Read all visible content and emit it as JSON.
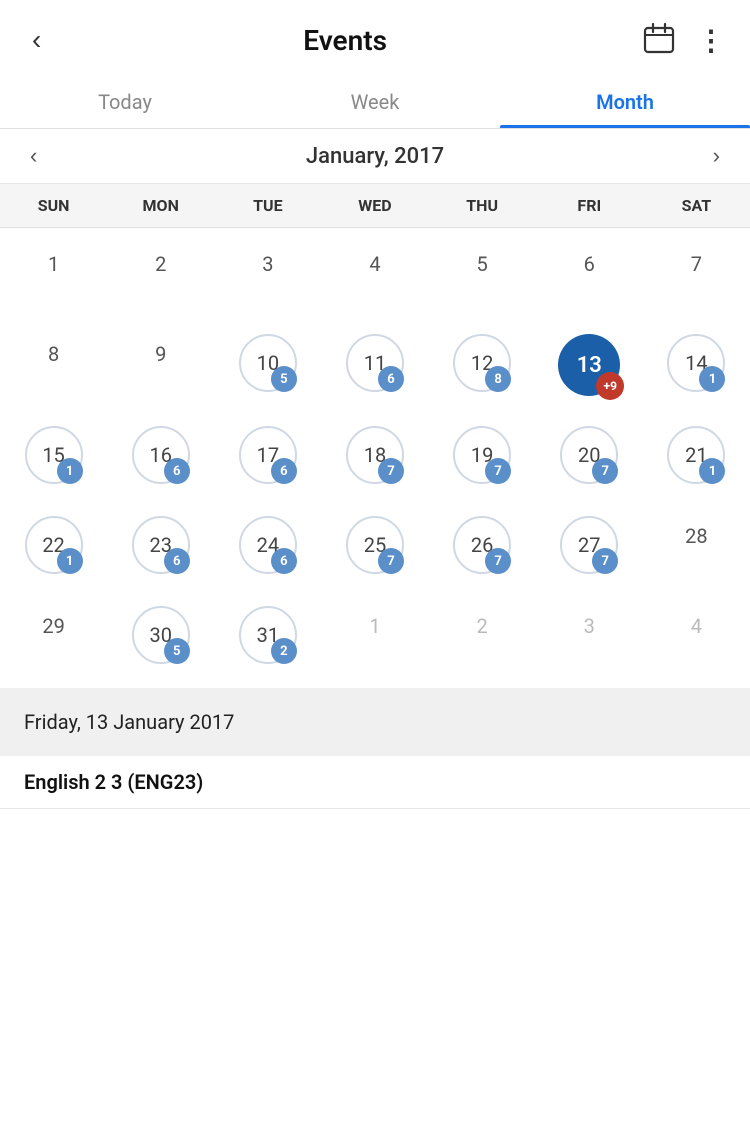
{
  "header": {
    "title": "Events",
    "back_label": "‹",
    "calendar_icon": "calendar-icon",
    "more_icon": "more-icon"
  },
  "tabs": [
    {
      "id": "today",
      "label": "Today",
      "active": false
    },
    {
      "id": "week",
      "label": "Week",
      "active": false
    },
    {
      "id": "month",
      "label": "Month",
      "active": true
    }
  ],
  "month_nav": {
    "title": "January, 2017",
    "prev_label": "‹",
    "next_label": "›"
  },
  "day_headers": [
    "SUN",
    "MON",
    "TUE",
    "WED",
    "THU",
    "FRI",
    "SAT"
  ],
  "calendar": {
    "weeks": [
      [
        {
          "date": "1",
          "other": false,
          "badge": null,
          "ring": false,
          "selected": false
        },
        {
          "date": "2",
          "other": false,
          "badge": null,
          "ring": false,
          "selected": false
        },
        {
          "date": "3",
          "other": false,
          "badge": null,
          "ring": false,
          "selected": false
        },
        {
          "date": "4",
          "other": false,
          "badge": null,
          "ring": false,
          "selected": false
        },
        {
          "date": "5",
          "other": false,
          "badge": null,
          "ring": false,
          "selected": false
        },
        {
          "date": "6",
          "other": false,
          "badge": null,
          "ring": false,
          "selected": false
        },
        {
          "date": "7",
          "other": false,
          "badge": null,
          "ring": false,
          "selected": false
        }
      ],
      [
        {
          "date": "8",
          "other": false,
          "badge": null,
          "ring": false,
          "selected": false
        },
        {
          "date": "9",
          "other": false,
          "badge": null,
          "ring": false,
          "selected": false
        },
        {
          "date": "10",
          "other": false,
          "badge": "5",
          "ring": true,
          "selected": false
        },
        {
          "date": "11",
          "other": false,
          "badge": "6",
          "ring": true,
          "selected": false
        },
        {
          "date": "12",
          "other": false,
          "badge": "8",
          "ring": true,
          "selected": false
        },
        {
          "date": "13",
          "other": false,
          "badge": "+9",
          "ring": false,
          "selected": true,
          "badge_red": true
        },
        {
          "date": "14",
          "other": false,
          "badge": "1",
          "ring": true,
          "selected": false
        }
      ],
      [
        {
          "date": "15",
          "other": false,
          "badge": "1",
          "ring": true,
          "selected": false
        },
        {
          "date": "16",
          "other": false,
          "badge": "6",
          "ring": true,
          "selected": false
        },
        {
          "date": "17",
          "other": false,
          "badge": "6",
          "ring": true,
          "selected": false
        },
        {
          "date": "18",
          "other": false,
          "badge": "7",
          "ring": true,
          "selected": false
        },
        {
          "date": "19",
          "other": false,
          "badge": "7",
          "ring": true,
          "selected": false
        },
        {
          "date": "20",
          "other": false,
          "badge": "7",
          "ring": true,
          "selected": false
        },
        {
          "date": "21",
          "other": false,
          "badge": "1",
          "ring": true,
          "selected": false
        }
      ],
      [
        {
          "date": "22",
          "other": false,
          "badge": "1",
          "ring": true,
          "selected": false
        },
        {
          "date": "23",
          "other": false,
          "badge": "6",
          "ring": true,
          "selected": false
        },
        {
          "date": "24",
          "other": false,
          "badge": "6",
          "ring": true,
          "selected": false
        },
        {
          "date": "25",
          "other": false,
          "badge": "7",
          "ring": true,
          "selected": false
        },
        {
          "date": "26",
          "other": false,
          "badge": "7",
          "ring": true,
          "selected": false
        },
        {
          "date": "27",
          "other": false,
          "badge": "7",
          "ring": true,
          "selected": false
        },
        {
          "date": "28",
          "other": false,
          "badge": null,
          "ring": false,
          "selected": false
        }
      ],
      [
        {
          "date": "29",
          "other": false,
          "badge": null,
          "ring": false,
          "selected": false
        },
        {
          "date": "30",
          "other": false,
          "badge": "5",
          "ring": true,
          "selected": false
        },
        {
          "date": "31",
          "other": false,
          "badge": "2",
          "ring": true,
          "selected": false
        },
        {
          "date": "1",
          "other": true,
          "badge": null,
          "ring": false,
          "selected": false
        },
        {
          "date": "2",
          "other": true,
          "badge": null,
          "ring": false,
          "selected": false
        },
        {
          "date": "3",
          "other": true,
          "badge": null,
          "ring": false,
          "selected": false
        },
        {
          "date": "4",
          "other": true,
          "badge": null,
          "ring": false,
          "selected": false
        }
      ]
    ]
  },
  "info_bar": {
    "date": "Friday, 13 January 2017"
  },
  "event_item": {
    "title": "English 2 3 (ENG23)"
  },
  "colors": {
    "selected_bg": "#1a5fa8",
    "badge_blue": "#5b8fc9",
    "badge_red": "#c0392b",
    "tab_active": "#1a73e8",
    "ring_color": "#d0d8e4"
  }
}
